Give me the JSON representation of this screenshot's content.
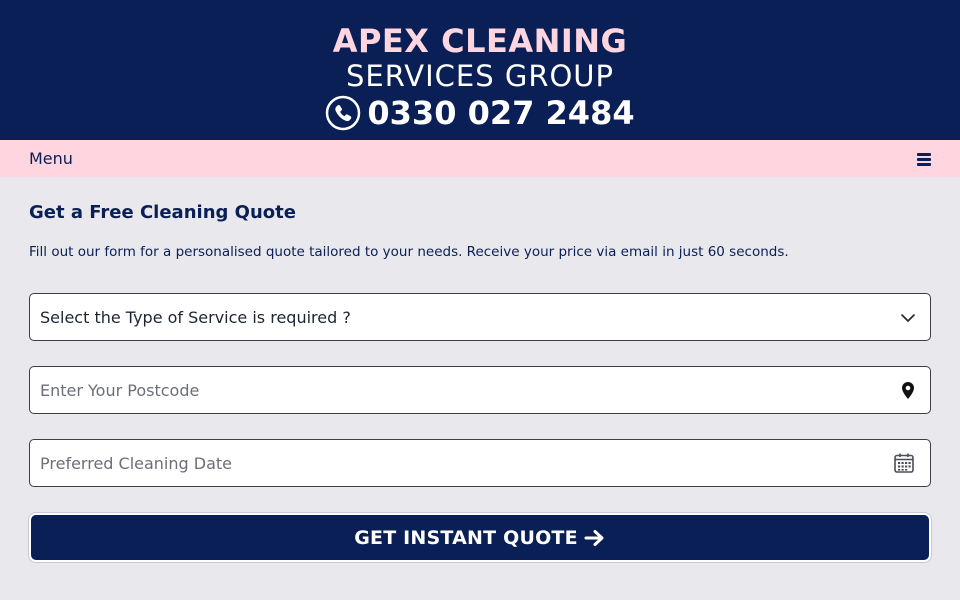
{
  "header": {
    "logo_line1": "APEX CLEANING",
    "logo_line2": "SERVICES GROUP",
    "phone": "0330 027 2484",
    "phone_icon": "phone-icon"
  },
  "nav": {
    "menu_label": "Menu",
    "menu_icon": "hamburger-icon"
  },
  "form": {
    "title": "Get a Free Cleaning Quote",
    "description": "Fill out our form for a personalised quote tailored to your needs. Receive your price via email in just 60 seconds.",
    "service_select": {
      "selected": "Select the Type of Service is required ?",
      "icon": "chevron-down-icon"
    },
    "postcode": {
      "placeholder": "Enter Your Postcode",
      "value": "",
      "icon": "map-pin-icon"
    },
    "date": {
      "placeholder": "Preferred Cleaning Date",
      "value": "",
      "icon": "calendar-icon"
    },
    "submit_label": "GET INSTANT QUOTE",
    "submit_icon": "arrow-right-icon"
  },
  "colors": {
    "navy": "#0a1f55",
    "pink": "#ffd6e0",
    "background": "#e9e9ed"
  }
}
